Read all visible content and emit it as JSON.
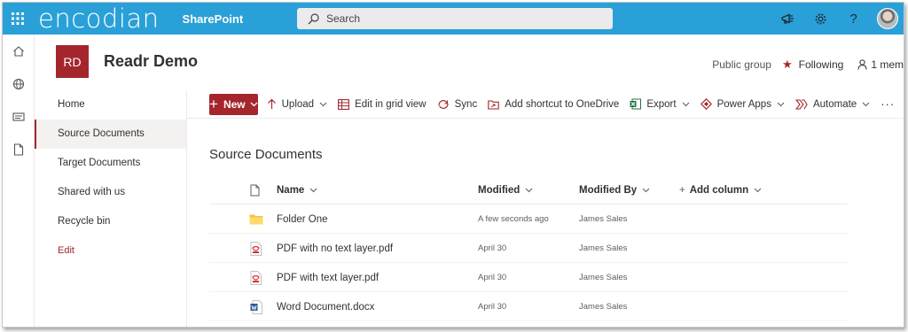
{
  "suitebar": {
    "brand": "encodian",
    "app_name": "SharePoint",
    "search_placeholder": "Search"
  },
  "site": {
    "logo_initials": "RD",
    "title": "Readr Demo",
    "privacy": "Public group",
    "following": "Following",
    "members": "1 mem"
  },
  "nav": {
    "items": [
      {
        "label": "Home"
      },
      {
        "label": "Source Documents"
      },
      {
        "label": "Target Documents"
      },
      {
        "label": "Shared with us"
      },
      {
        "label": "Recycle bin"
      }
    ],
    "edit_label": "Edit",
    "active_index": 1
  },
  "commands": {
    "new_label": "New",
    "upload": "Upload",
    "grid": "Edit in grid view",
    "sync": "Sync",
    "shortcut": "Add shortcut to OneDrive",
    "export": "Export",
    "power_apps": "Power Apps",
    "automate": "Automate",
    "more": "···"
  },
  "library": {
    "title": "Source Documents",
    "columns": {
      "name": "Name",
      "modified": "Modified",
      "modified_by": "Modified By",
      "add_column": "Add column"
    },
    "rows": [
      {
        "name": "Folder One",
        "modified": "A few seconds ago",
        "modified_by": "James Sales",
        "type": "folder"
      },
      {
        "name": "PDF with no text layer.pdf",
        "modified": "April 30",
        "modified_by": "James Sales",
        "type": "pdf"
      },
      {
        "name": "PDF with text layer.pdf",
        "modified": "April 30",
        "modified_by": "James Sales",
        "type": "pdf"
      },
      {
        "name": "Word Document.docx",
        "modified": "April 30",
        "modified_by": "James Sales",
        "type": "word"
      }
    ]
  },
  "colors": {
    "suitebar": "#2aa0d8",
    "accent": "#a4262c",
    "folder": "#f5c542",
    "excel": "#217346",
    "word": "#2b579a"
  }
}
